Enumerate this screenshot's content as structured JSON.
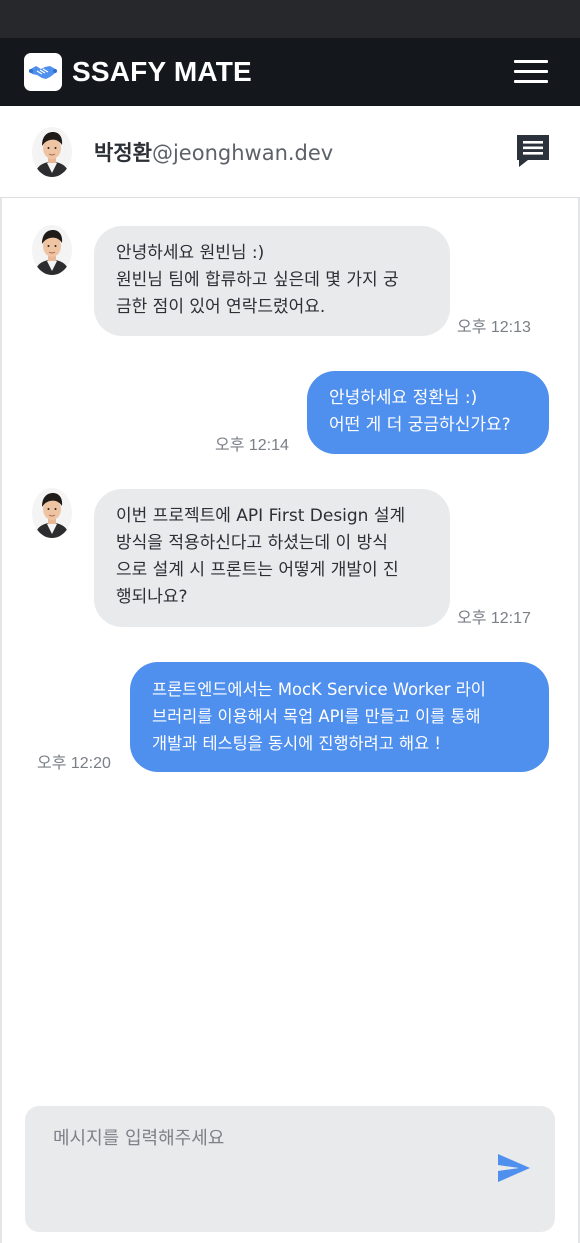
{
  "app": {
    "title": "SSAFY MATE",
    "logo_icon": "handshake-icon",
    "menu_icon": "hamburger-menu-icon"
  },
  "chat_header": {
    "name": "박정환",
    "handle": "@jeonghwan.dev",
    "chat_icon": "chat-bubble-icon"
  },
  "messages": [
    {
      "from": "peer",
      "lines": [
        "안녕하세요 원빈님 :)",
        "원빈님 팀에 합류하고 싶은데 몇 가지 궁",
        "금한 점이 있어 연락드렸어요."
      ],
      "time": "오후 12:13"
    },
    {
      "from": "me",
      "lines": [
        "안녕하세요 정환님 :)",
        "어떤 게 더 궁금하신가요?"
      ],
      "time": "오후 12:14"
    },
    {
      "from": "peer",
      "lines": [
        "이번 프로젝트에 API First Design 설계",
        "방식을 적용하신다고 하셨는데 이 방식",
        "으로 설계 시 프론트는 어떻게 개발이 진",
        "행되나요?"
      ],
      "time": "오후 12:17"
    },
    {
      "from": "me",
      "lines": [
        "프론트엔드에서는 MocK Service Worker 라이",
        "브러리를 이용해서 목업 API를 만들고 이를 통해",
        "개발과 테스팅을 동시에 진행하려고 해요 !"
      ],
      "time": "오후 12:20"
    }
  ],
  "composer": {
    "placeholder": "메시지를 입력해주세요",
    "value": "",
    "send_icon": "send-icon"
  },
  "colors": {
    "app_bar": "#14181d",
    "outgoing_bubble": "#4f8fee",
    "incoming_bubble": "#e9eaec",
    "send_icon": "#4f8fee"
  }
}
